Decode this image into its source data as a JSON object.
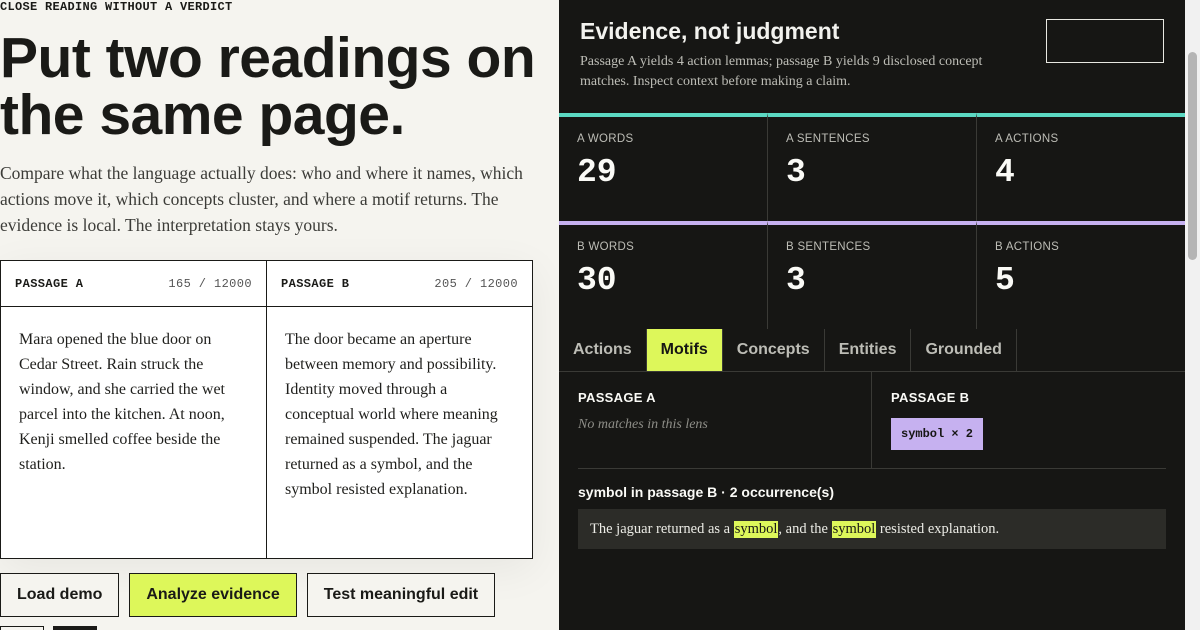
{
  "hero": {
    "eyebrow": "CLOSE READING WITHOUT A VERDICT",
    "headline": "Put two readings on the same page.",
    "intro": "Compare what the language actually does: who and where it names, which actions move it, which concepts cluster, and where a motif returns. The evidence is local. The interpretation stays yours."
  },
  "passages": {
    "a": {
      "title": "PASSAGE A",
      "count": "165 / 12000",
      "text": "Mara opened the blue door on Cedar Street. Rain struck the window, and she carried the wet parcel into the kitchen. At noon, Kenji smelled coffee beside the station."
    },
    "b": {
      "title": "PASSAGE B",
      "count": "205 / 12000",
      "text": "The door became an aperture between memory and possibility. Identity moved through a conceptual world where meaning remained suspended. The jaguar returned as a symbol, and the symbol resisted explanation."
    }
  },
  "buttons": {
    "load_demo": "Load demo",
    "analyze": "Analyze evidence",
    "test_edit": "Test meaningful edit"
  },
  "panel": {
    "title": "Evidence, not judgment",
    "subtitle": "Passage A yields 4 action lemmas; passage B yields 9 disclosed concept matches. Inspect context before making a claim.",
    "stats_a": [
      {
        "label": "A WORDS",
        "value": "29"
      },
      {
        "label": "A SENTENCES",
        "value": "3"
      },
      {
        "label": "A ACTIONS",
        "value": "4"
      }
    ],
    "stats_b": [
      {
        "label": "B WORDS",
        "value": "30"
      },
      {
        "label": "B SENTENCES",
        "value": "3"
      },
      {
        "label": "B ACTIONS",
        "value": "5"
      }
    ],
    "tabs": [
      "Actions",
      "Motifs",
      "Concepts",
      "Entities",
      "Grounded"
    ],
    "active_tab": "Motifs",
    "lens": {
      "a_head": "PASSAGE A",
      "a_empty": "No matches in this lens",
      "b_head": "PASSAGE B",
      "b_chip": "symbol × 2"
    },
    "occurrence": {
      "title": "symbol in passage B · 2 occurrence(s)",
      "pre": "The jaguar returned as a ",
      "hl1": "symbol",
      "mid": ", and the ",
      "hl2": "symbol",
      "post": " resisted explanation."
    }
  },
  "colors": {
    "accent": "#ddf75a",
    "passage_a": "#5cd9c3",
    "passage_b": "#c6b1f0",
    "panel_bg": "#161614"
  }
}
